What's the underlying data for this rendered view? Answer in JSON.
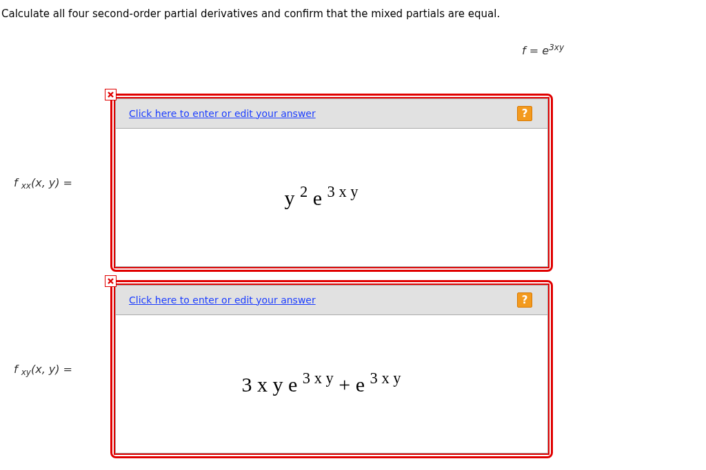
{
  "question": "Calculate all four second-order partial derivatives and confirm that the mixed partials are equal.",
  "function": "f = e$^{3xy}$",
  "answers": [
    {
      "label": "f $_{xx}$(x, y) =",
      "link": "Click here to enter or edit your answer",
      "help": "?",
      "answer": "y $^{2}$ e $^{3 x y}$",
      "incorrect": true
    },
    {
      "label": "f $_{xy}$(x, y) =",
      "link": "Click here to enter or edit your answer",
      "help": "?",
      "answer": "3 x y e $^{3 x y}$ + e $^{3 x y}$",
      "incorrect": true
    }
  ]
}
